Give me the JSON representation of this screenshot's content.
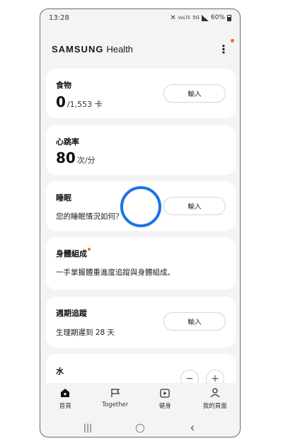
{
  "status_bar": {
    "time": "13:28",
    "network": "5G",
    "volte": "VoLTE",
    "battery": "60%"
  },
  "header": {
    "brand": "SAMSUNG",
    "product": "Health"
  },
  "cards": {
    "food": {
      "title": "食物",
      "value": "0",
      "unit": "/1,553 卡",
      "button": "輸入"
    },
    "heart_rate": {
      "title": "心跳率",
      "value": "80",
      "unit": "次/分"
    },
    "sleep": {
      "title": "睡眠",
      "desc": "您的睡眠情況如何？",
      "button": "輸入"
    },
    "body_composition": {
      "title": "身體組成",
      "desc": "一手掌握體重進度追蹤與身體組成。"
    },
    "cycle_tracking": {
      "title": "週期追蹤",
      "desc": "生理期遲到 28 天",
      "button": "輸入"
    },
    "water": {
      "title": "水",
      "minus": "−",
      "plus": "+"
    }
  },
  "bottom_nav": {
    "home": "首頁",
    "together": "Together",
    "fitness": "健身",
    "my_page": "我的頁面"
  },
  "system_nav": {
    "recents": "|||",
    "home": "◯",
    "back": "‹"
  },
  "colors": {
    "accent_dot": "#f06a1e",
    "touch_ring": "#1a73e8",
    "background": "#f4f4f4",
    "card": "#ffffff"
  }
}
